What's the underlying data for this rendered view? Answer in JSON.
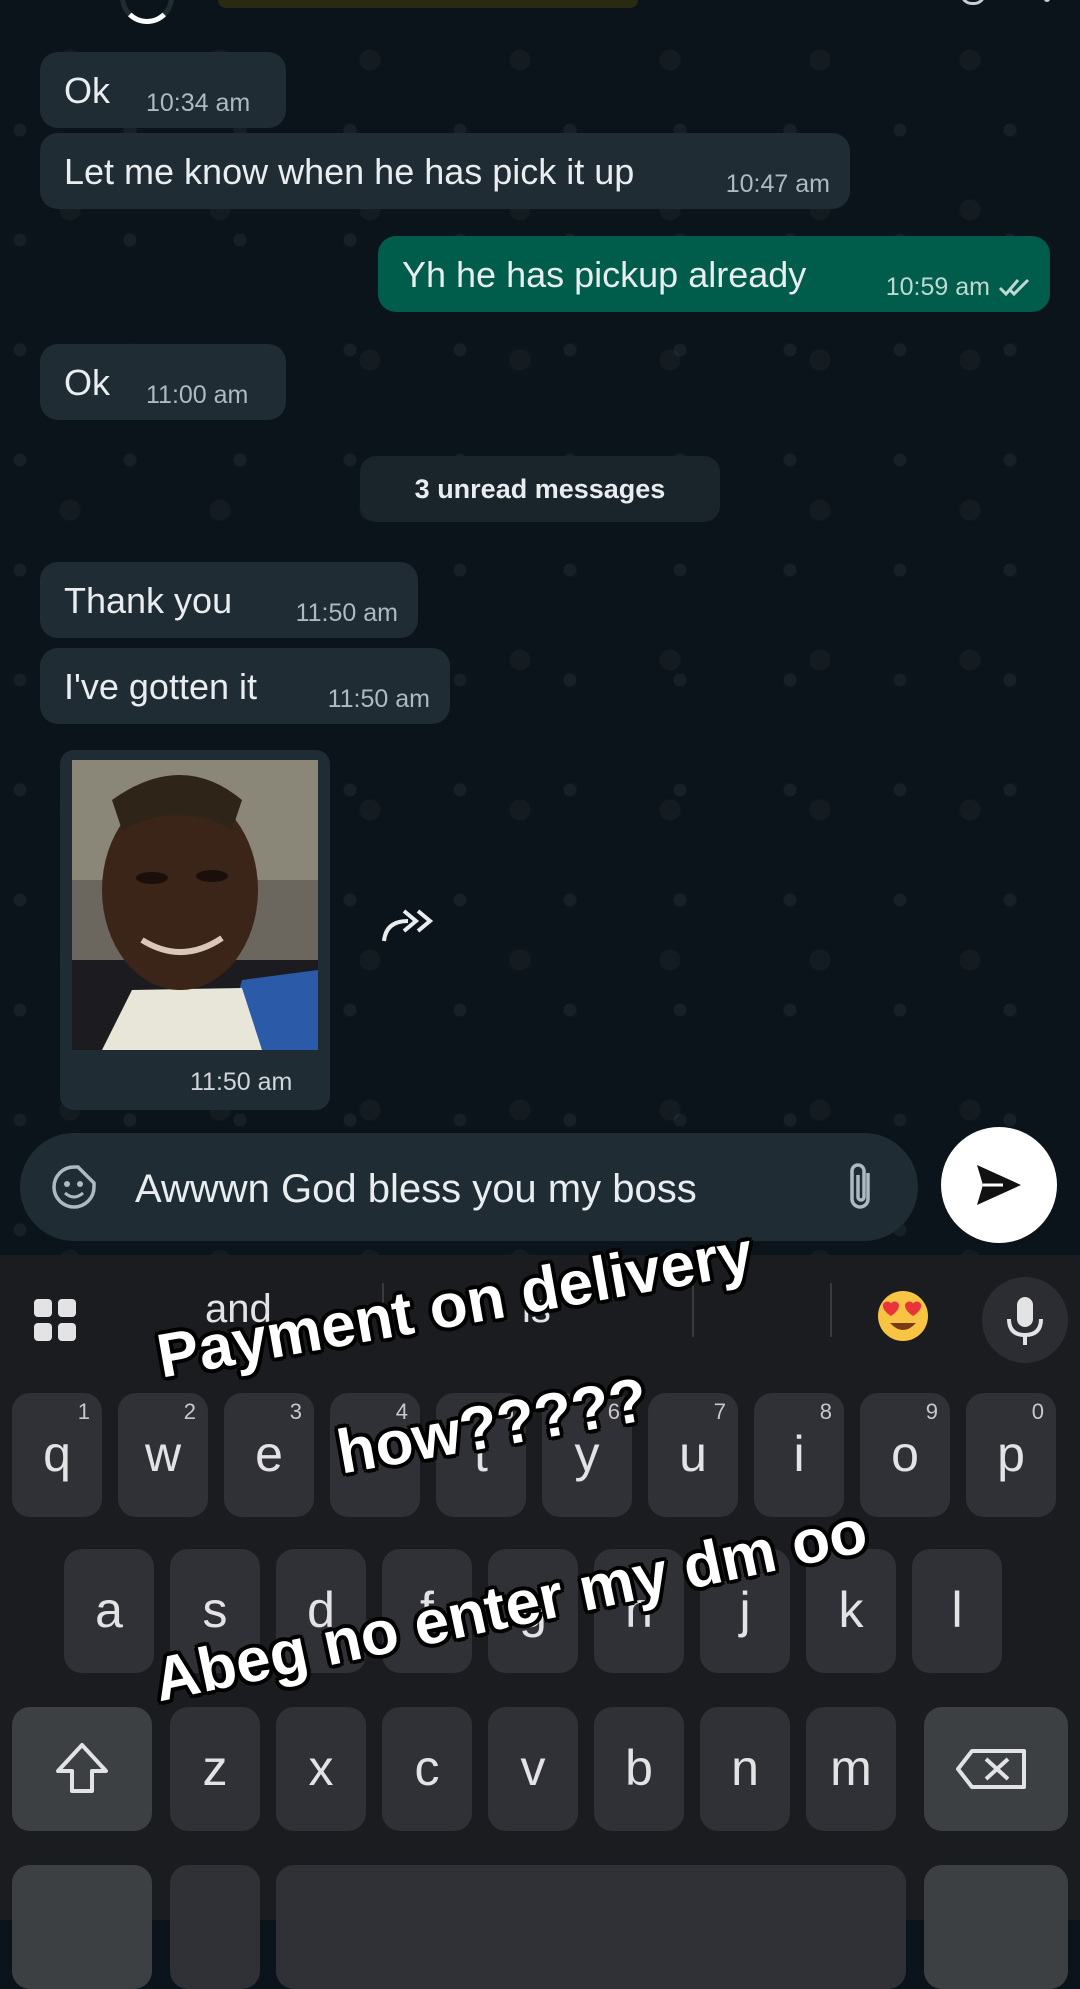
{
  "messages": [
    {
      "dir": "in",
      "text": "Ok",
      "time": "10:34 am"
    },
    {
      "dir": "in",
      "text": "Let me know when he has pick it up",
      "time": "10:47 am"
    },
    {
      "dir": "out",
      "text": "Yh he has pickup already",
      "time": "10:59 am",
      "status": "read"
    },
    {
      "dir": "in",
      "text": "Ok",
      "time": "11:00 am"
    },
    {
      "dir": "in",
      "text": "Thank you",
      "time": "11:50 am"
    },
    {
      "dir": "in",
      "text": "I've gotten it",
      "time": "11:50 am"
    }
  ],
  "unread_banner": "3 unread messages",
  "photo_message": {
    "time": "11:50 am"
  },
  "composer": {
    "text": "Awwwn God bless you my boss"
  },
  "keyboard": {
    "suggestions": [
      "and",
      "is"
    ],
    "suggested_emoji": "heart-eyes",
    "row1": [
      {
        "key": "q",
        "sup": "1"
      },
      {
        "key": "w",
        "sup": "2"
      },
      {
        "key": "e",
        "sup": "3"
      },
      {
        "key": "r",
        "sup": "4"
      },
      {
        "key": "t",
        "sup": "5"
      },
      {
        "key": "y",
        "sup": "6"
      },
      {
        "key": "u",
        "sup": "7"
      },
      {
        "key": "i",
        "sup": "8"
      },
      {
        "key": "o",
        "sup": "9"
      },
      {
        "key": "p",
        "sup": "0"
      }
    ],
    "row2": [
      "a",
      "s",
      "d",
      "f",
      "g",
      "h",
      "j",
      "k",
      "l"
    ],
    "row3": [
      "z",
      "x",
      "c",
      "v",
      "b",
      "n",
      "m"
    ]
  },
  "overlay_captions": [
    "Payment on delivery",
    "how?????",
    "Abeg no enter my dm oo"
  ],
  "colors": {
    "incoming": "#202c33",
    "outgoing": "#005c4b",
    "background": "#0b141a"
  }
}
